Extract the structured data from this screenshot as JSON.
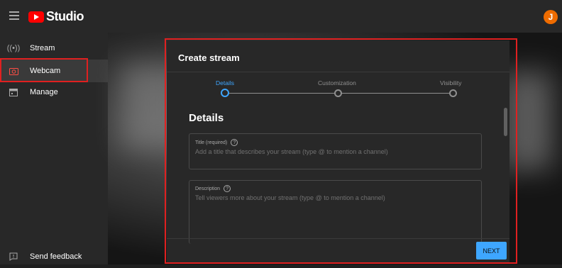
{
  "app": {
    "title": "Studio",
    "avatar_letter": "J",
    "avatar_color": "#ef6c00",
    "accent": "#3ea6ff"
  },
  "sidebar": {
    "items": [
      {
        "label": "Stream",
        "icon": "broadcast-icon"
      },
      {
        "label": "Webcam",
        "icon": "camera-icon",
        "active": true
      },
      {
        "label": "Manage",
        "icon": "calendar-icon"
      }
    ],
    "feedback_label": "Send feedback"
  },
  "dialog": {
    "title": "Create stream",
    "steps": [
      {
        "label": "Details",
        "active": true
      },
      {
        "label": "Customization"
      },
      {
        "label": "Visibility"
      }
    ],
    "section_title": "Details",
    "title_field": {
      "label": "Title (required)",
      "placeholder": "Add a title that describes your stream (type @ to mention a channel)"
    },
    "description_field": {
      "label": "Description",
      "placeholder": "Tell viewers more about your stream (type @ to mention a channel)"
    },
    "next_label": "NEXT"
  }
}
